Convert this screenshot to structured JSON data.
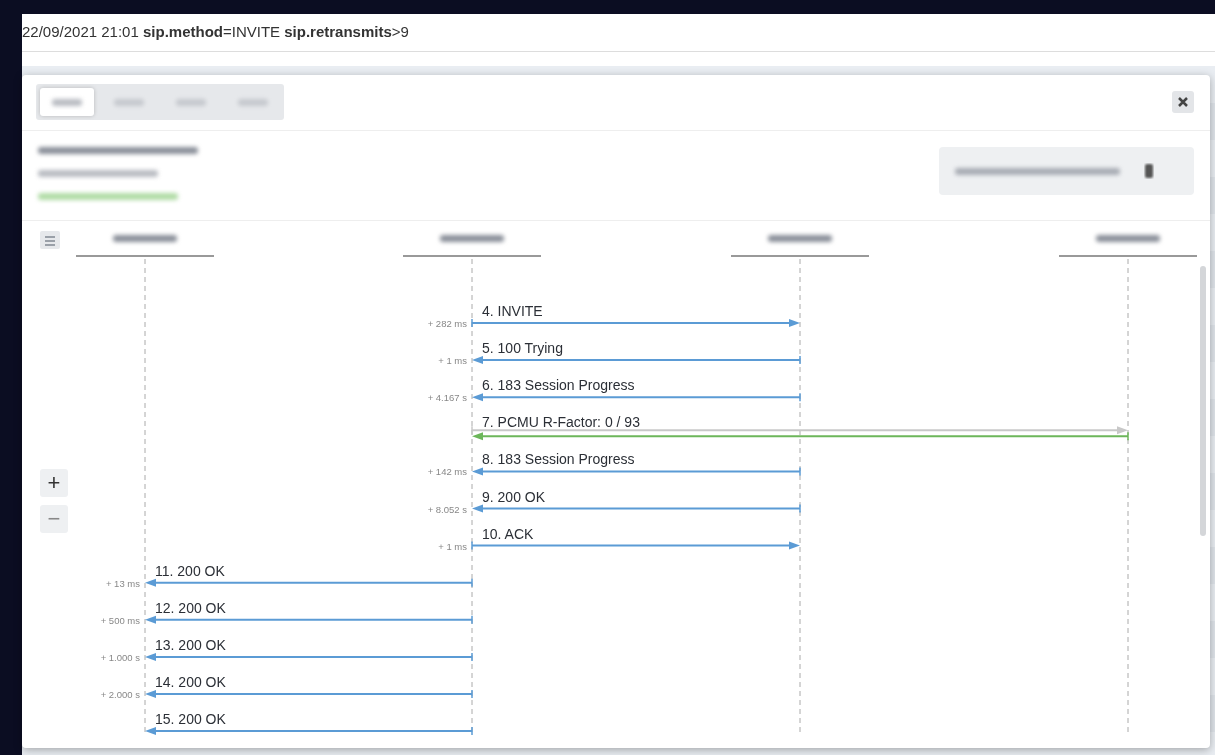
{
  "search_bar": {
    "query": "22/09/2021 21:01 **sip.method**=INVITE **sip.retransmits**>9"
  },
  "modal": {
    "tabs": [
      {
        "selected": true
      },
      {
        "selected": false
      },
      {
        "selected": false
      },
      {
        "selected": false
      }
    ],
    "zoom_in": "+",
    "zoom_out": "−",
    "messages": [
      {
        "label": "4. INVITE",
        "delay": "+ 282 ms",
        "kind": "outbound"
      },
      {
        "label": "5. 100 Trying",
        "delay": "+ 1 ms",
        "kind": "inbound"
      },
      {
        "label": "6. 183 Session Progress",
        "delay": "+ 4.167 s",
        "kind": "inbound"
      },
      {
        "label": "7. PCMU R-Factor: 0 / 93",
        "kind": "media"
      },
      {
        "label": "8. 183 Session Progress",
        "delay": "+ 142 ms",
        "kind": "inbound"
      },
      {
        "label": "9. 200 OK",
        "delay": "+ 8.052 s",
        "kind": "inbound"
      },
      {
        "label": "10. ACK",
        "delay": "+ 1 ms",
        "kind": "outbound"
      },
      {
        "label": "11. 200 OK",
        "delay": "+ 13 ms",
        "kind": "relay"
      },
      {
        "label": "12. 200 OK",
        "delay": "+ 500 ms",
        "kind": "relay"
      },
      {
        "label": "13. 200 OK",
        "delay": "+ 1.000 s",
        "kind": "relay"
      },
      {
        "label": "14. 200 OK",
        "delay": "+ 2.000 s",
        "kind": "relay"
      },
      {
        "label": "15. 200 OK",
        "kind": "relay"
      }
    ]
  }
}
